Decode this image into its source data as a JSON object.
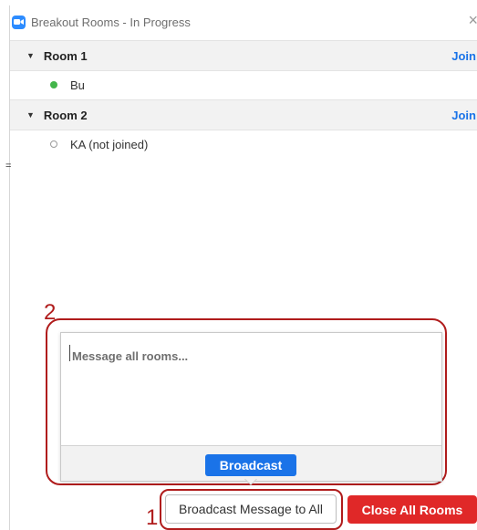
{
  "window": {
    "title": "Breakout Rooms - In Progress",
    "close_glyph": "×",
    "icon": "zoom-camera-icon"
  },
  "rooms": [
    {
      "name": "Room 1",
      "join_label": "Join",
      "participants": [
        {
          "name": "Bu",
          "status": "joined"
        }
      ]
    },
    {
      "name": "Room 2",
      "join_label": "Join",
      "participants": [
        {
          "name": "KA (not joined)",
          "status": "not-joined"
        }
      ]
    }
  ],
  "broadcast_popup": {
    "placeholder": "Message all rooms...",
    "value": "",
    "broadcast_label": "Broadcast"
  },
  "footer": {
    "broadcast_all_label": "Broadcast Message to All",
    "close_all_label": "Close All Rooms"
  },
  "annotations": {
    "marker_1": "1",
    "marker_2": "2",
    "color": "#b01c1c"
  },
  "colors": {
    "accent": "#1a73e8",
    "danger": "#e02828",
    "joined": "#43b54a"
  }
}
